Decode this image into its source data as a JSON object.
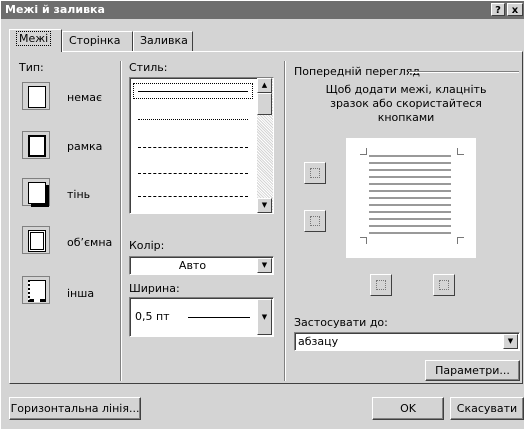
{
  "window": {
    "title": "Межі й заливка",
    "help_glyph": "?",
    "close_glyph": "x"
  },
  "tabs": [
    {
      "label": "Межі",
      "access": "М"
    },
    {
      "label": "Сторінка",
      "access": "С"
    },
    {
      "label": "Заливка",
      "access": "З"
    }
  ],
  "type_section": {
    "title": "Тип:",
    "items": [
      {
        "label": "немає"
      },
      {
        "label": "рамка"
      },
      {
        "label": "тінь"
      },
      {
        "label": "об’ємна"
      },
      {
        "label": "інша"
      }
    ]
  },
  "style_section": {
    "title": "Стиль:"
  },
  "color": {
    "label": "Колір:",
    "value": "Авто"
  },
  "width": {
    "label": "Ширина:",
    "value": "0,5 пт"
  },
  "preview": {
    "title": "Попередній перегляд",
    "hint": "Щоб додати межі, клацніть зразок або скористайтеся кнопками"
  },
  "apply": {
    "label": "Застосувати до:",
    "value": "абзацу"
  },
  "buttons": {
    "params": "Параметри...",
    "horizontal_line": "Горизонтальна лінія...",
    "ok": "OK",
    "cancel": "Скасувати"
  }
}
